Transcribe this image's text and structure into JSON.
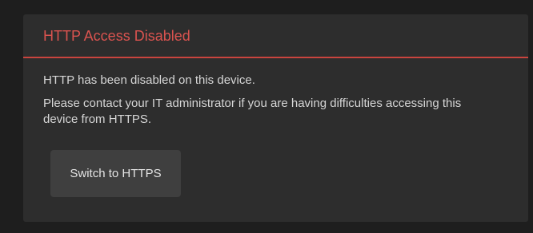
{
  "panel": {
    "title": "HTTP Access Disabled",
    "message_1": "HTTP has been disabled on this device.",
    "message_2": "Please contact your IT administrator if you are having difficulties accessing this device from HTTPS.",
    "switch_button_label": "Switch to HTTPS"
  },
  "colors": {
    "page_background": "#1e1e1e",
    "panel_background": "#2d2d2d",
    "title_red": "#d9534f",
    "divider_red": "#c9443e",
    "body_text": "#d6d6d6",
    "button_background": "#3f3f3f"
  }
}
